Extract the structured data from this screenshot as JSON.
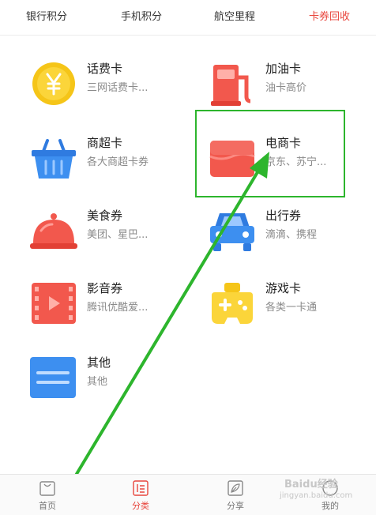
{
  "tabs": [
    {
      "label": "银行积分",
      "active": false
    },
    {
      "label": "手机积分",
      "active": false
    },
    {
      "label": "航空里程",
      "active": false
    },
    {
      "label": "卡券回收",
      "active": true
    }
  ],
  "items": [
    {
      "title": "话费卡",
      "subtitle": "三网话费卡...",
      "icon": "yen-coin-icon"
    },
    {
      "title": "加油卡",
      "subtitle": "油卡高价",
      "icon": "fuel-pump-icon"
    },
    {
      "title": "商超卡",
      "subtitle": "各大商超卡券",
      "icon": "shopping-basket-icon"
    },
    {
      "title": "电商卡",
      "subtitle": "京东、苏宁...",
      "icon": "ecommerce-card-icon"
    },
    {
      "title": "美食券",
      "subtitle": "美团、星巴...",
      "icon": "food-cloche-icon"
    },
    {
      "title": "出行券",
      "subtitle": "滴滴、携程",
      "icon": "car-icon"
    },
    {
      "title": "影音券",
      "subtitle": "腾讯优酷爱...",
      "icon": "film-icon"
    },
    {
      "title": "游戏卡",
      "subtitle": "各类一卡通",
      "icon": "gamepad-icon"
    },
    {
      "title": "其他",
      "subtitle": "其他",
      "icon": "other-card-icon"
    }
  ],
  "bottom_nav": [
    {
      "label": "首页",
      "icon": "home-bag-icon",
      "active": false
    },
    {
      "label": "分类",
      "icon": "category-icon",
      "active": true
    },
    {
      "label": "分享",
      "icon": "share-leaf-icon",
      "active": false
    },
    {
      "label": "我的",
      "icon": "profile-icon",
      "active": false
    }
  ],
  "watermark": {
    "text": "Baidu经验",
    "url": "jingyan.baidu.com"
  },
  "colors": {
    "accent": "#e8453c",
    "annotation": "#2db52d"
  }
}
